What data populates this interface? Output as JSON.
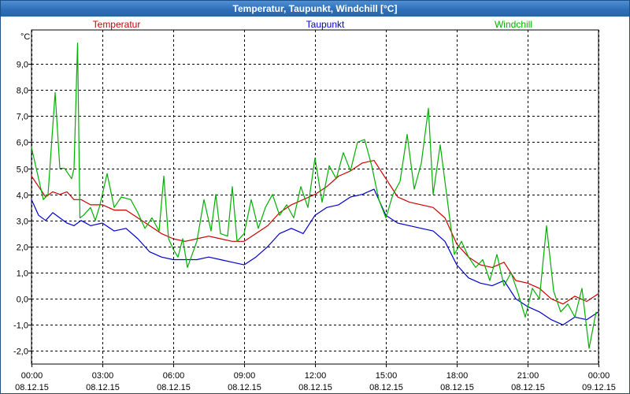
{
  "window": {
    "title": "Temperatur, Taupunkt, Windchill [°C]"
  },
  "chart_data": {
    "type": "line",
    "title": "Temperatur, Taupunkt, Windchill [°C]",
    "ylabel": "°C",
    "xlabel": "",
    "ylim": [
      -2.5,
      10.3
    ],
    "xlim": [
      0,
      24
    ],
    "grid": true,
    "legend_position": "top",
    "y_ticks": [
      "-2,0",
      "-1,0",
      "0,0",
      "1,0",
      "2,0",
      "3,0",
      "4,0",
      "5,0",
      "6,0",
      "7,0",
      "8,0",
      "9,0"
    ],
    "x_ticks": [
      {
        "time": "00:00",
        "date": "08.12.15"
      },
      {
        "time": "03:00",
        "date": "08.12.15"
      },
      {
        "time": "06:00",
        "date": "08.12.15"
      },
      {
        "time": "09:00",
        "date": "08.12.15"
      },
      {
        "time": "12:00",
        "date": "08.12.15"
      },
      {
        "time": "15:00",
        "date": "08.12.15"
      },
      {
        "time": "18:00",
        "date": "08.12.15"
      },
      {
        "time": "21:00",
        "date": "08.12.15"
      },
      {
        "time": "00:00",
        "date": "09.12.15"
      }
    ],
    "series": [
      {
        "name": "Temperatur",
        "color": "#cc0000",
        "x": [
          0,
          0.3,
          0.6,
          0.9,
          1.2,
          1.5,
          1.8,
          2.1,
          2.5,
          3.0,
          3.5,
          4.0,
          4.5,
          5.0,
          5.5,
          6.0,
          6.5,
          7.0,
          7.5,
          8.0,
          8.5,
          9.0,
          9.5,
          10.0,
          10.5,
          11.0,
          11.5,
          12.0,
          12.5,
          13.0,
          13.5,
          14.0,
          14.5,
          15.0,
          15.5,
          16.0,
          16.5,
          17.0,
          17.5,
          18.0,
          18.5,
          19.0,
          19.5,
          20.0,
          20.5,
          21.0,
          21.5,
          22.0,
          22.5,
          23.0,
          23.5,
          24.0
        ],
        "y": [
          4.7,
          4.3,
          3.9,
          4.1,
          4.0,
          4.1,
          3.8,
          3.8,
          3.6,
          3.6,
          3.4,
          3.4,
          3.1,
          2.8,
          2.5,
          2.3,
          2.2,
          2.3,
          2.4,
          2.3,
          2.2,
          2.2,
          2.5,
          2.8,
          3.3,
          3.6,
          3.8,
          4.0,
          4.3,
          4.7,
          4.9,
          5.2,
          5.3,
          4.6,
          3.9,
          3.7,
          3.6,
          3.5,
          3.1,
          2.1,
          1.6,
          1.3,
          1.2,
          1.4,
          0.7,
          0.6,
          0.4,
          0.0,
          -0.2,
          0.1,
          -0.1,
          0.2
        ]
      },
      {
        "name": "Taupunkt",
        "color": "#0000cc",
        "x": [
          0,
          0.3,
          0.6,
          0.9,
          1.2,
          1.5,
          1.8,
          2.1,
          2.5,
          3.0,
          3.5,
          4.0,
          4.5,
          5.0,
          5.5,
          6.0,
          6.5,
          7.0,
          7.5,
          8.0,
          8.5,
          9.0,
          9.5,
          10.0,
          10.5,
          11.0,
          11.5,
          12.0,
          12.5,
          13.0,
          13.5,
          14.0,
          14.5,
          15.0,
          15.5,
          16.0,
          16.5,
          17.0,
          17.5,
          18.0,
          18.5,
          19.0,
          19.5,
          20.0,
          20.5,
          21.0,
          21.5,
          22.0,
          22.5,
          23.0,
          23.5,
          24.0
        ],
        "y": [
          3.8,
          3.2,
          3.0,
          3.3,
          3.1,
          2.9,
          2.8,
          3.0,
          2.8,
          2.9,
          2.6,
          2.7,
          2.3,
          1.8,
          1.6,
          1.5,
          1.5,
          1.5,
          1.6,
          1.5,
          1.4,
          1.3,
          1.6,
          2.0,
          2.5,
          2.7,
          2.5,
          3.2,
          3.5,
          3.6,
          3.9,
          4.0,
          4.2,
          3.2,
          2.9,
          2.8,
          2.7,
          2.6,
          2.2,
          1.3,
          0.8,
          0.6,
          0.5,
          0.7,
          0.0,
          -0.3,
          -0.5,
          -0.8,
          -1.0,
          -0.7,
          -0.8,
          -0.5
        ]
      },
      {
        "name": "Windchill",
        "color": "#00b000",
        "x": [
          0,
          0.3,
          0.5,
          0.7,
          1.0,
          1.2,
          1.4,
          1.7,
          1.8,
          1.95,
          2.05,
          2.2,
          2.5,
          2.7,
          2.9,
          3.2,
          3.5,
          3.8,
          4.2,
          4.5,
          4.8,
          5.1,
          5.4,
          5.6,
          5.8,
          6.0,
          6.2,
          6.4,
          6.6,
          7.0,
          7.3,
          7.6,
          7.8,
          8.0,
          8.3,
          8.5,
          8.7,
          9.0,
          9.3,
          9.6,
          9.9,
          10.2,
          10.5,
          10.8,
          11.1,
          11.4,
          11.7,
          12.0,
          12.3,
          12.6,
          12.9,
          13.2,
          13.5,
          13.8,
          14.1,
          14.4,
          14.7,
          15.0,
          15.3,
          15.6,
          15.9,
          16.2,
          16.5,
          16.8,
          17.0,
          17.3,
          17.6,
          17.9,
          18.2,
          18.5,
          18.8,
          19.1,
          19.4,
          19.7,
          20.0,
          20.3,
          20.6,
          20.9,
          21.2,
          21.5,
          21.8,
          22.1,
          22.4,
          22.7,
          23.0,
          23.3,
          23.6,
          23.9
        ],
        "y": [
          5.8,
          4.6,
          3.8,
          4.0,
          7.9,
          5.0,
          5.0,
          4.6,
          5.0,
          9.8,
          3.1,
          3.2,
          3.5,
          3.0,
          3.6,
          4.8,
          3.5,
          3.9,
          3.8,
          3.3,
          2.7,
          3.1,
          2.6,
          4.7,
          2.3,
          1.9,
          1.6,
          2.3,
          1.2,
          2.2,
          3.8,
          2.6,
          4.0,
          2.5,
          2.4,
          4.3,
          2.2,
          2.5,
          3.8,
          2.7,
          3.5,
          4.0,
          3.2,
          3.6,
          3.1,
          4.3,
          3.5,
          5.4,
          3.7,
          5.1,
          4.6,
          5.6,
          4.9,
          6.0,
          6.1,
          5.1,
          3.8,
          3.1,
          4.0,
          4.5,
          6.3,
          4.2,
          5.2,
          7.3,
          4.0,
          5.9,
          3.8,
          1.7,
          2.2,
          1.6,
          1.2,
          1.5,
          0.7,
          1.7,
          0.5,
          1.0,
          0.2,
          -0.7,
          0.4,
          0.0,
          2.8,
          0.3,
          -0.5,
          -0.2,
          -0.7,
          0.4,
          -1.9,
          -0.5
        ]
      }
    ]
  }
}
